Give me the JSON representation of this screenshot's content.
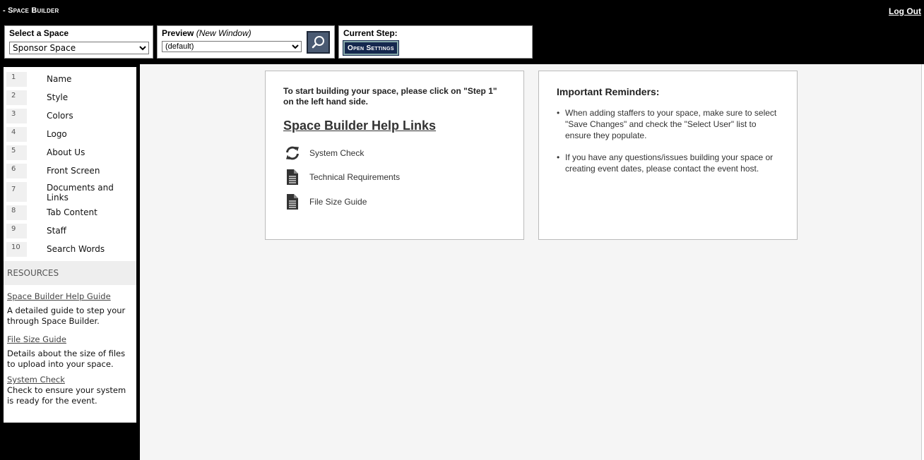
{
  "header": {
    "app_title": "- Space Builder",
    "logout_label": "Log Out"
  },
  "space_selector": {
    "label": "Select a Space",
    "selected": "Sponsor Space"
  },
  "preview": {
    "label": "Preview",
    "label_note": "(New Window)",
    "selected": "(default)",
    "button_icon": "search-icon"
  },
  "current_step": {
    "label": "Current Step:",
    "button_label": "Open Settings"
  },
  "steps": [
    {
      "num": "1",
      "label": "Name"
    },
    {
      "num": "2",
      "label": "Style"
    },
    {
      "num": "3",
      "label": "Colors"
    },
    {
      "num": "4",
      "label": "Logo"
    },
    {
      "num": "5",
      "label": "About Us"
    },
    {
      "num": "6",
      "label": "Front Screen"
    },
    {
      "num": "7",
      "label": "Documents and Links"
    },
    {
      "num": "8",
      "label": "Tab Content"
    },
    {
      "num": "9",
      "label": "Staff"
    },
    {
      "num": "10",
      "label": "Search Words"
    }
  ],
  "resources": {
    "heading": "RESOURCES",
    "items": [
      {
        "link": "Space Builder Help Guide",
        "desc": "A detailed guide to step your through Space Builder."
      },
      {
        "link": "File Size Guide",
        "desc": "Details about the size of files to upload into your space."
      },
      {
        "link": "System Check",
        "desc": "Check to ensure your system is ready for the event."
      }
    ]
  },
  "help_panel": {
    "intro": "To start building your space, please click on \"Step 1\" on the left hand side.",
    "title": "Space Builder Help Links",
    "links": [
      {
        "label": "System Check",
        "icon": "refresh-icon"
      },
      {
        "label": "Technical Requirements",
        "icon": "document-icon"
      },
      {
        "label": "File Size Guide",
        "icon": "document-icon"
      }
    ]
  },
  "reminders": {
    "title": "Important Reminders:",
    "items": [
      "When adding staffers to your space, make sure to select \"Save Changes\" and check the \"Select User\" list to ensure they populate.",
      "If you have any questions/issues building your space or creating event dates, please contact the event host."
    ]
  },
  "colors": {
    "background": "#000000",
    "button_navy": "#15284e",
    "preview_button": "#4a5a72"
  }
}
